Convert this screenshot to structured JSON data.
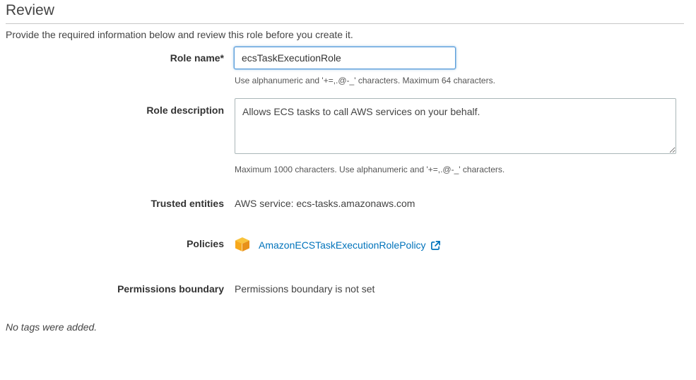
{
  "header": {
    "title": "Review",
    "intro": "Provide the required information below and review this role before you create it."
  },
  "form": {
    "role_name": {
      "label": "Role name*",
      "value": "ecsTaskExecutionRole",
      "hint": "Use alphanumeric and '+=,.@-_' characters. Maximum 64 characters."
    },
    "role_description": {
      "label": "Role description",
      "value": "Allows ECS tasks to call AWS services on your behalf.",
      "hint": "Maximum 1000 characters. Use alphanumeric and '+=,.@-_' characters."
    },
    "trusted_entities": {
      "label": "Trusted entities",
      "value": "AWS service: ecs-tasks.amazonaws.com"
    },
    "policies": {
      "label": "Policies",
      "items": [
        {
          "name": "AmazonECSTaskExecutionRolePolicy",
          "icon": "policy-box-icon",
          "link_icon": "external-link-icon"
        }
      ]
    },
    "permissions_boundary": {
      "label": "Permissions boundary",
      "value": "Permissions boundary is not set"
    }
  },
  "tags": {
    "empty_text": "No tags were added."
  },
  "colors": {
    "link": "#0073bb",
    "policy_icon": "#f7a81b",
    "input_focus": "#5b9dd9"
  }
}
